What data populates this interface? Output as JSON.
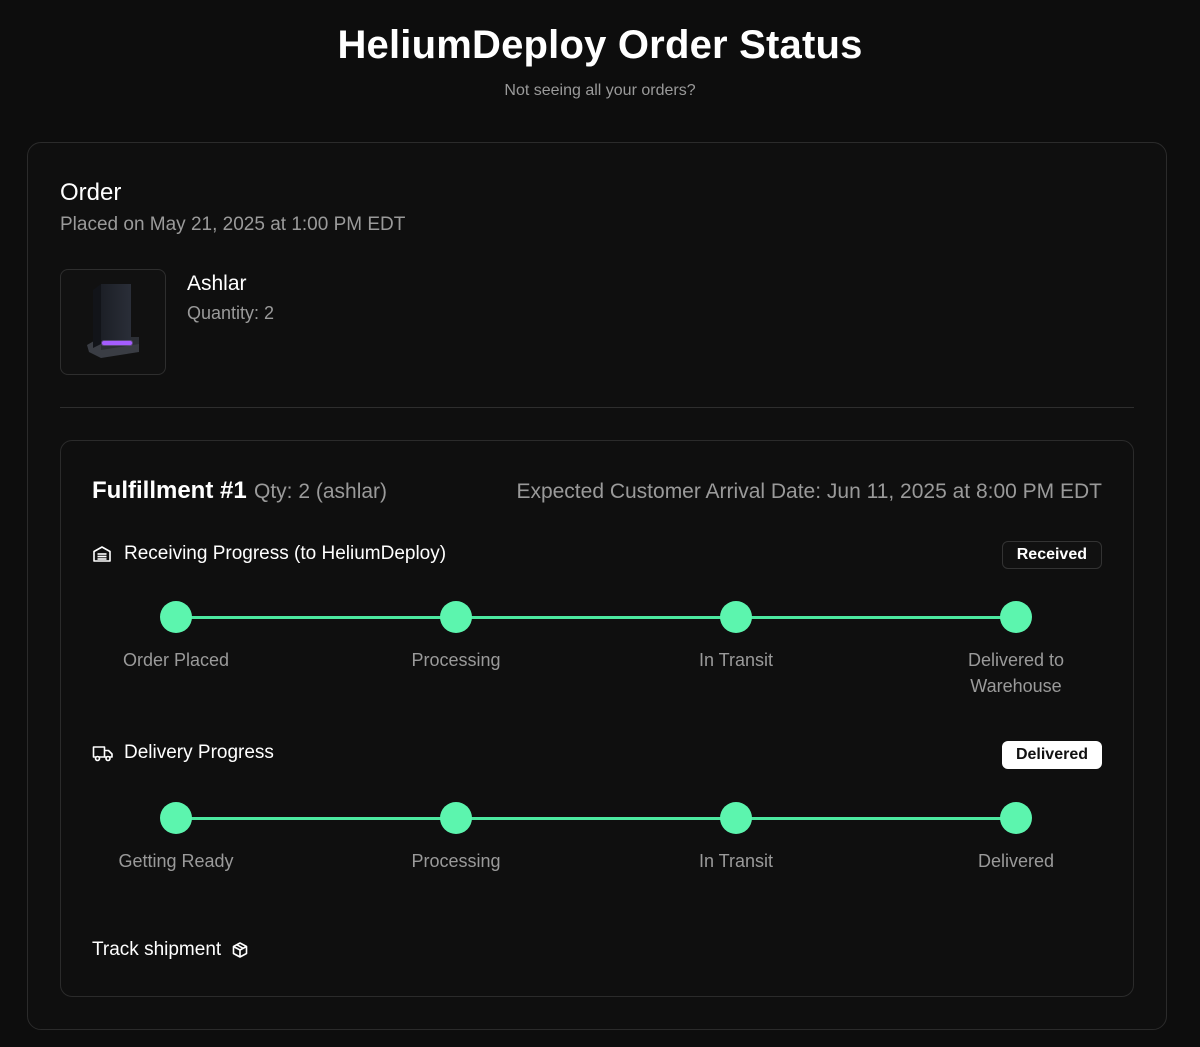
{
  "header": {
    "title": "HeliumDeploy Order Status",
    "subtitle": "Not seeing all your orders?"
  },
  "order": {
    "title": "Order",
    "placed": "Placed on May 21, 2025 at 1:00 PM EDT",
    "product": {
      "name": "Ashlar",
      "quantity": "Quantity: 2",
      "image_icon": "device-tower-icon"
    }
  },
  "fulfillment": {
    "title": "Fulfillment #1",
    "qty": "Qty: 2 (ashlar)",
    "eta": "Expected Customer Arrival Date: Jun 11, 2025 at 8:00 PM EDT",
    "receiving": {
      "icon": "warehouse-icon",
      "label": "Receiving Progress (to HeliumDeploy)",
      "status": "Received",
      "progress_percent": 100,
      "steps": [
        "Order Placed",
        "Processing",
        "In Transit",
        "Delivered to Warehouse"
      ]
    },
    "delivery": {
      "icon": "truck-icon",
      "label": "Delivery Progress",
      "status": "Delivered",
      "progress_percent": 100,
      "steps": [
        "Getting Ready",
        "Processing",
        "In Transit",
        "Delivered"
      ]
    },
    "track": {
      "label": "Track shipment",
      "icon": "package-icon"
    }
  },
  "colors": {
    "background": "#0d0d0d",
    "accent_green": "#5cf5ae",
    "muted_text": "#9a9a9a"
  }
}
